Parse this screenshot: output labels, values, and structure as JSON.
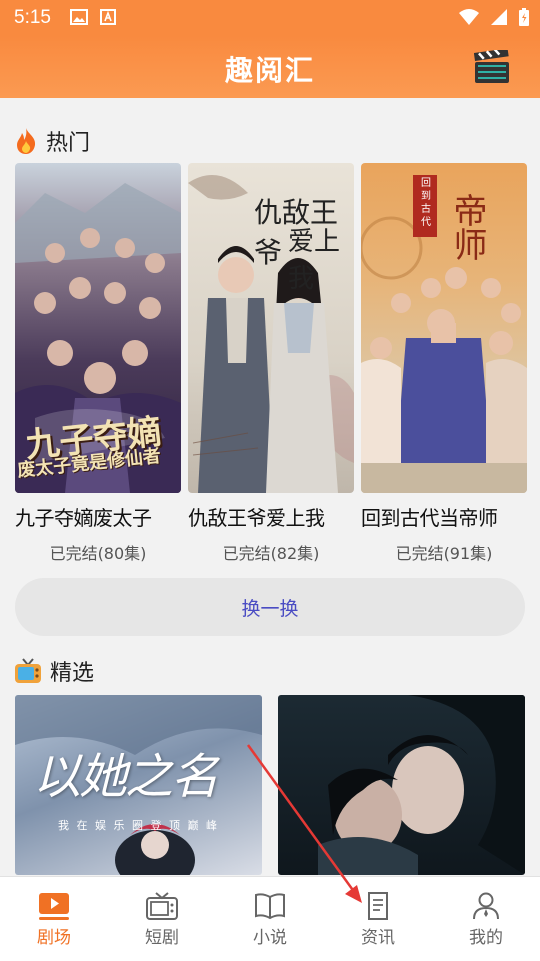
{
  "status_bar": {
    "time": "5:15"
  },
  "header": {
    "title": "趣阅汇"
  },
  "hot_section": {
    "title": "热门",
    "items": [
      {
        "title": "九子夺嫡废太子",
        "status": "已完结(80集)",
        "poster_text": "九子夺嫡",
        "poster_subtext": "废太子竟是修仙者"
      },
      {
        "title": "仇敌王爷爱上我",
        "status": "已完结(82集)",
        "poster_text": "仇敌王爷",
        "poster_subtext": "爱上我"
      },
      {
        "title": "回到古代当帝师",
        "status": "已完结(91集)",
        "poster_text": "帝师",
        "poster_subtext": "回到古代"
      }
    ],
    "refresh_label": "换一换"
  },
  "featured_section": {
    "title": "精选",
    "items": [
      {
        "poster_text": "以她之名",
        "poster_subtext": "我 在 娱 乐 圈 登 顶 巅 峰"
      },
      {
        "poster_text": ""
      }
    ]
  },
  "bottom_nav": {
    "items": [
      {
        "label": "剧场",
        "icon": "play-icon",
        "active": true
      },
      {
        "label": "短剧",
        "icon": "tv-icon",
        "active": false
      },
      {
        "label": "小说",
        "icon": "book-icon",
        "active": false
      },
      {
        "label": "资讯",
        "icon": "document-icon",
        "active": false
      },
      {
        "label": "我的",
        "icon": "user-icon",
        "active": false
      }
    ]
  },
  "colors": {
    "accent": "#f98a3f",
    "active_nav": "#f07124",
    "refresh_text": "#4a4cc3",
    "annotation_arrow": "#e53935"
  }
}
